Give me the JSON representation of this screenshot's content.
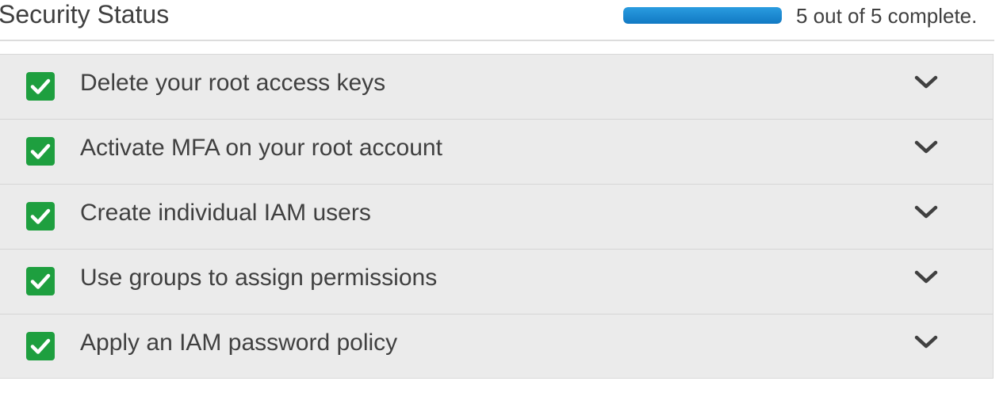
{
  "header": {
    "title": "Security Status",
    "progress": {
      "completed": 5,
      "total": 5,
      "fraction": 1.0,
      "text": "5 out of 5 complete.",
      "color": "#1a8ad4"
    }
  },
  "checklist": {
    "items": [
      {
        "label": "Delete your root access keys",
        "status": "complete",
        "icon": "check-icon",
        "expand_icon": "chevron-down-icon"
      },
      {
        "label": "Activate MFA on your root account",
        "status": "complete",
        "icon": "check-icon",
        "expand_icon": "chevron-down-icon"
      },
      {
        "label": "Create individual IAM users",
        "status": "complete",
        "icon": "check-icon",
        "expand_icon": "chevron-down-icon"
      },
      {
        "label": "Use groups to assign permissions",
        "status": "complete",
        "icon": "check-icon",
        "expand_icon": "chevron-down-icon"
      },
      {
        "label": "Apply an IAM password policy",
        "status": "complete",
        "icon": "check-icon",
        "expand_icon": "chevron-down-icon"
      }
    ],
    "complete_color": "#1e9f3f"
  }
}
